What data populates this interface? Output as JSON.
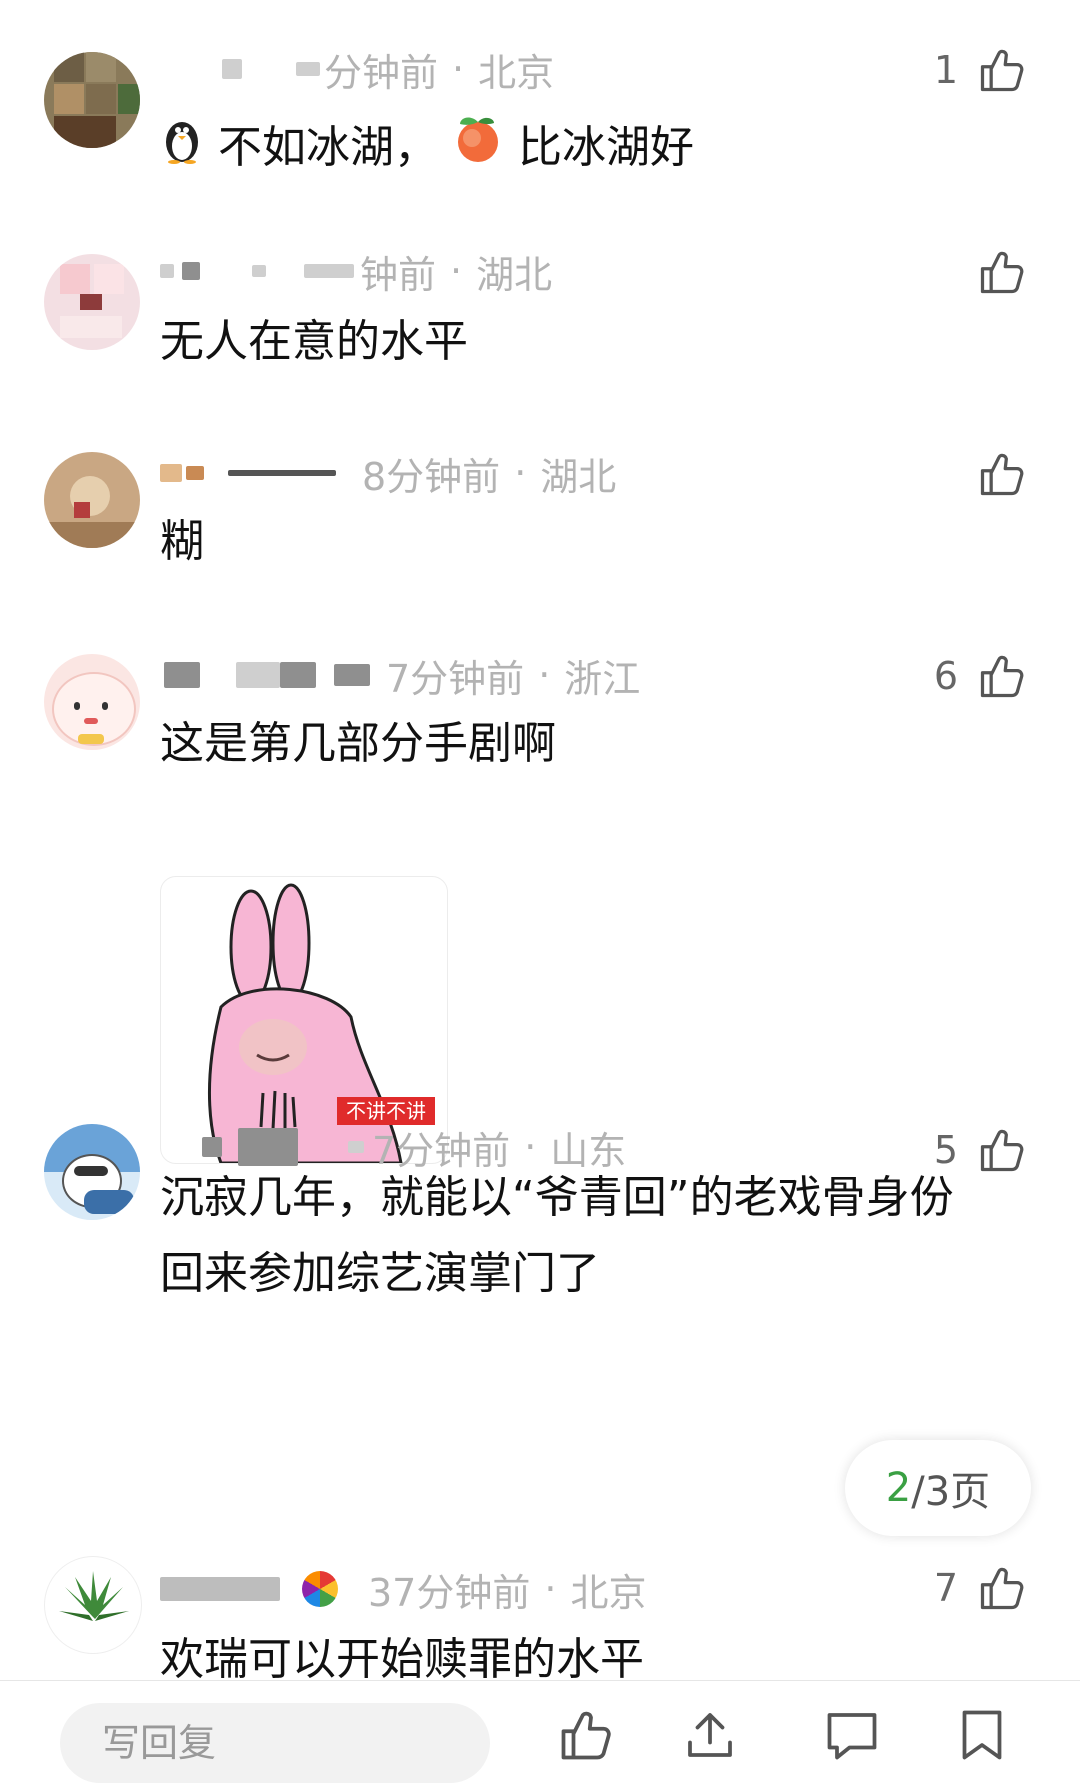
{
  "comments": [
    {
      "time": "分钟前",
      "location": "北京",
      "text_a": "不如冰湖，",
      "text_b": "比冰湖好",
      "likes": "1"
    },
    {
      "time": "钟前",
      "location": "湖北",
      "text": "无人在意的水平",
      "likes": ""
    },
    {
      "time": "8分钟前",
      "location": "湖北",
      "text": "糊",
      "likes": ""
    },
    {
      "time": "7分钟前",
      "location": "浙江",
      "text": "这是第几部分手剧啊",
      "sticker_label": "不讲不讲",
      "likes": "6"
    },
    {
      "time": "7分钟前",
      "location": "山东",
      "text_line1": "沉寂几年，就能以“爷青回”的老戏骨身份",
      "text_line2": "回来参加综艺演掌门了",
      "likes": "5"
    },
    {
      "time": "37分钟前",
      "location": "北京",
      "text": "欢瑞可以开始赎罪的水平",
      "likes": "7"
    }
  ],
  "separator": "·",
  "pager": {
    "current": "2",
    "rest": "/3页"
  },
  "bottom_bar": {
    "reply_placeholder": "写回复"
  },
  "colors": {
    "accent": "#3aa043",
    "meta_gray": "#b3b3b3"
  },
  "icons": [
    "thumbs-up-icon",
    "penguin-emoji-icon",
    "peach-emoji-icon",
    "share-icon",
    "comment-icon",
    "bookmark-icon"
  ]
}
